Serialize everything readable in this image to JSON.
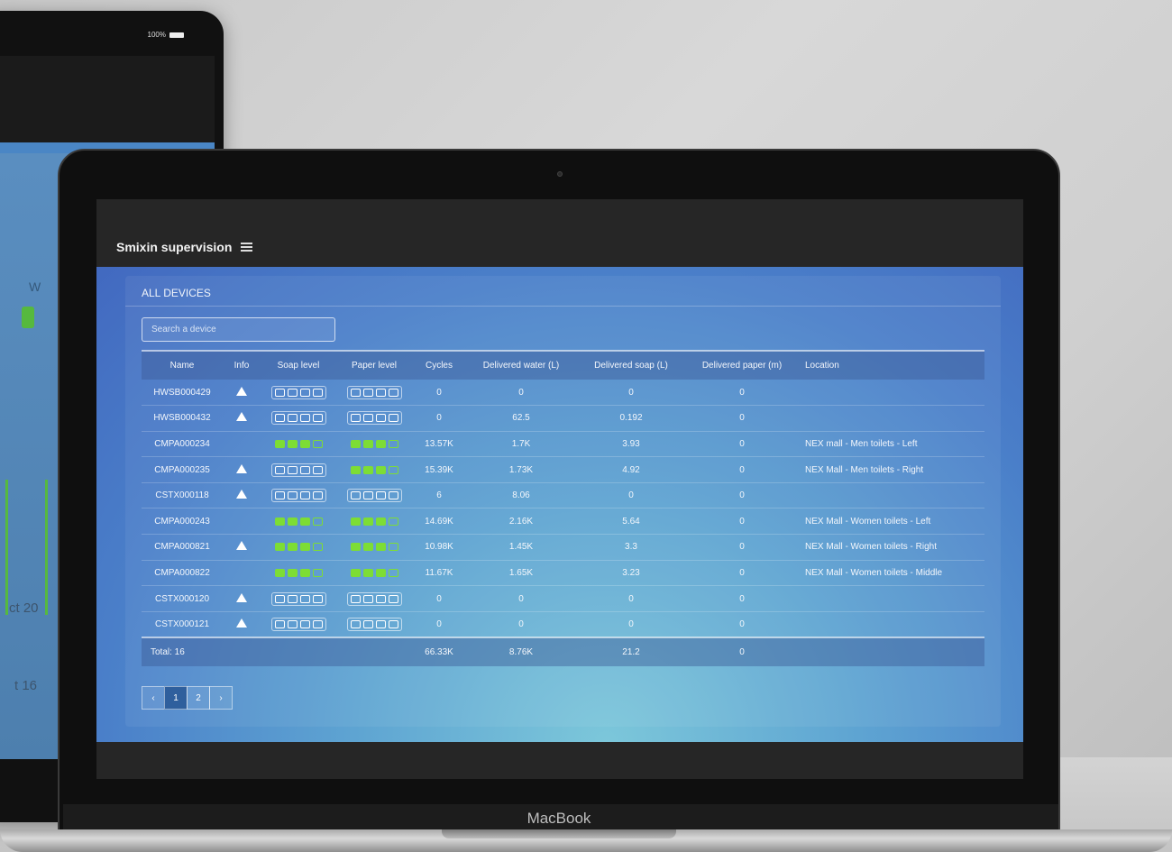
{
  "tablet": {
    "status_text": "100%",
    "axis_label_1": "ct 20",
    "axis_label_2": "t 16",
    "w_letter": "W"
  },
  "laptop": {
    "brand": "MacBook"
  },
  "app": {
    "title": "Smixin supervision",
    "panel_title": "ALL DEVICES",
    "search_placeholder": "Search a device",
    "columns": [
      "Name",
      "Info",
      "Soap level",
      "Paper level",
      "Cycles",
      "Delivered water (L)",
      "Delivered soap (L)",
      "Delivered paper (m)",
      "Location"
    ],
    "rows": [
      {
        "name": "HWSB000429",
        "warn": true,
        "soap": [
          0,
          0,
          0,
          0
        ],
        "paper": [
          0,
          0,
          0,
          0
        ],
        "cycles": "0",
        "water": "0",
        "soapd": "0",
        "paperd": "0",
        "location": ""
      },
      {
        "name": "HWSB000432",
        "warn": true,
        "soap": [
          0,
          0,
          0,
          0
        ],
        "paper": [
          0,
          0,
          0,
          0
        ],
        "cycles": "0",
        "water": "62.5",
        "soapd": "0.192",
        "paperd": "0",
        "location": ""
      },
      {
        "name": "CMPA000234",
        "warn": false,
        "soap": [
          1,
          1,
          1,
          0
        ],
        "paper": [
          1,
          1,
          1,
          0
        ],
        "cycles": "13.57K",
        "water": "1.7K",
        "soapd": "3.93",
        "paperd": "0",
        "location": "NEX mall - Men toilets - Left"
      },
      {
        "name": "CMPA000235",
        "warn": true,
        "soap": [
          0,
          0,
          0,
          0
        ],
        "paper": [
          1,
          1,
          1,
          0
        ],
        "cycles": "15.39K",
        "water": "1.73K",
        "soapd": "4.92",
        "paperd": "0",
        "location": "NEX Mall - Men toilets - Right"
      },
      {
        "name": "CSTX000118",
        "warn": true,
        "soap": [
          0,
          0,
          0,
          0
        ],
        "paper": [
          0,
          0,
          0,
          0
        ],
        "cycles": "6",
        "water": "8.06",
        "soapd": "0",
        "paperd": "0",
        "location": ""
      },
      {
        "name": "CMPA000243",
        "warn": false,
        "soap": [
          1,
          1,
          1,
          0
        ],
        "paper": [
          1,
          1,
          1,
          0
        ],
        "cycles": "14.69K",
        "water": "2.16K",
        "soapd": "5.64",
        "paperd": "0",
        "location": "NEX Mall - Women toilets - Left"
      },
      {
        "name": "CMPA000821",
        "warn": true,
        "soap": [
          1,
          1,
          1,
          0
        ],
        "paper": [
          1,
          1,
          1,
          0
        ],
        "cycles": "10.98K",
        "water": "1.45K",
        "soapd": "3.3",
        "paperd": "0",
        "location": "NEX Mall - Women toilets - Right"
      },
      {
        "name": "CMPA000822",
        "warn": false,
        "soap": [
          1,
          1,
          1,
          0
        ],
        "paper": [
          1,
          1,
          1,
          0
        ],
        "cycles": "11.67K",
        "water": "1.65K",
        "soapd": "3.23",
        "paperd": "0",
        "location": "NEX Mall - Women toilets - Middle"
      },
      {
        "name": "CSTX000120",
        "warn": true,
        "soap": [
          0,
          0,
          0,
          0
        ],
        "paper": [
          0,
          0,
          0,
          0
        ],
        "cycles": "0",
        "water": "0",
        "soapd": "0",
        "paperd": "0",
        "location": ""
      },
      {
        "name": "CSTX000121",
        "warn": true,
        "soap": [
          0,
          0,
          0,
          0
        ],
        "paper": [
          0,
          0,
          0,
          0
        ],
        "cycles": "0",
        "water": "0",
        "soapd": "0",
        "paperd": "0",
        "location": ""
      }
    ],
    "totals": {
      "label": "Total: 16",
      "cycles": "66.33K",
      "water": "8.76K",
      "soapd": "21.2",
      "paperd": "0"
    },
    "pager": {
      "prev": "‹",
      "pages": [
        "1",
        "2"
      ],
      "next": "›",
      "active_page": "1"
    },
    "colors": {
      "level_on": "#7ddd35",
      "accent": "#2f5f9d"
    }
  }
}
